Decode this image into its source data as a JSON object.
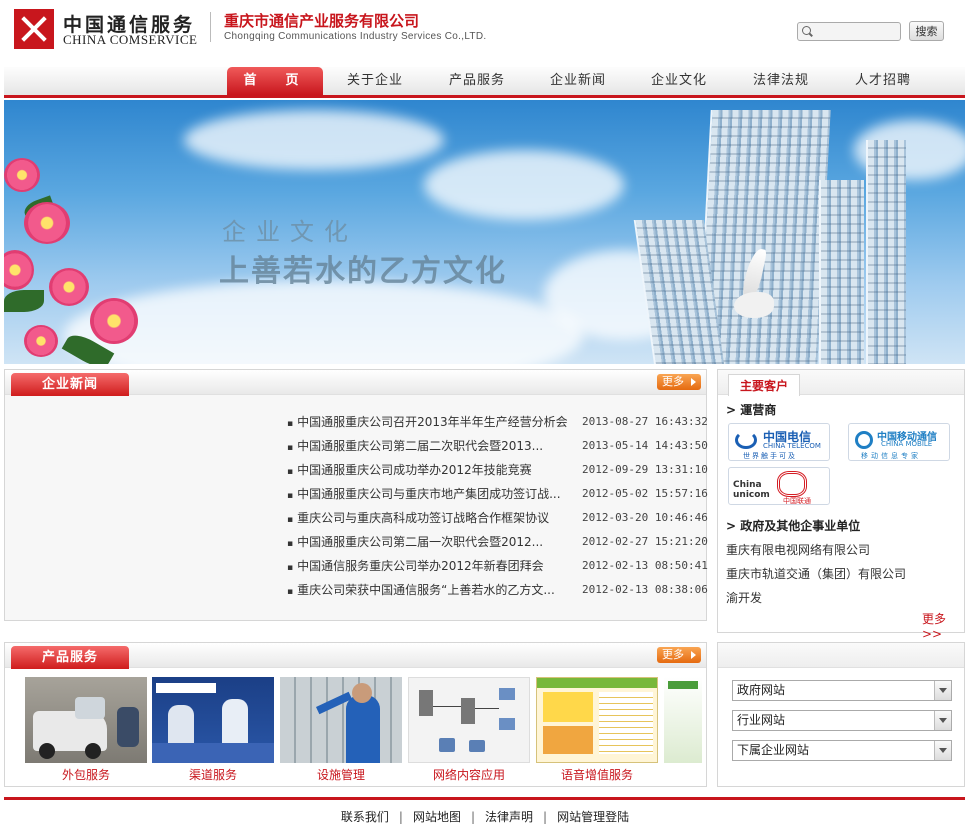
{
  "header": {
    "brand_cn": "中国通信服务",
    "brand_en": "CHINA COMSERVICE",
    "company_cn": "重庆市通信产业服务有限公司",
    "company_en": "Chongqing Communications Industry Services Co.,LTD.",
    "search_placeholder": "",
    "search_button": "搜索"
  },
  "nav": [
    "首　页",
    "关于企业",
    "产品服务",
    "企业新闻",
    "企业文化",
    "法律法规",
    "人才招聘"
  ],
  "banner": {
    "line1": "企业文化",
    "line2": "上善若水的乙方文化"
  },
  "news": {
    "title": "企业新闻",
    "more": "更多",
    "items": [
      {
        "title": "中国通服重庆公司召开2013年半年生产经营分析会",
        "date": "2013-08-27 16:43:32"
      },
      {
        "title": "中国通服重庆公司第二届二次职代会暨2013...",
        "date": "2013-05-14 14:43:50"
      },
      {
        "title": "中国通服重庆公司成功举办2012年技能竞赛",
        "date": "2012-09-29 13:31:10"
      },
      {
        "title": "中国通服重庆公司与重庆市地产集团成功签订战...",
        "date": "2012-05-02 15:57:16"
      },
      {
        "title": "重庆公司与重庆高科成功签订战略合作框架协议",
        "date": "2012-03-20 10:46:46"
      },
      {
        "title": "中国通服重庆公司第二届一次职代会暨2012...",
        "date": "2012-02-27 15:21:20"
      },
      {
        "title": "中国通信服务重庆公司举办2012年新春团拜会",
        "date": "2012-02-13 08:50:41"
      },
      {
        "title": "重庆公司荣获中国通信服务“上善若水的乙方文...",
        "date": "2012-02-13 08:38:06"
      }
    ]
  },
  "customers": {
    "title": "主要客户",
    "operators_heading": "運营商",
    "operators": [
      {
        "cn": "中国电信",
        "en": "CHINA TELECOM",
        "slogan": "世界触手可及"
      },
      {
        "cn": "中国移动通信",
        "en": "CHINA MOBILE",
        "slogan": "移动信息专家"
      },
      {
        "cn": "中国联通",
        "en": "China unicom"
      }
    ],
    "gov_heading": "政府及其他企事业单位",
    "gov": [
      "重庆有限电视网络有限公司",
      "重庆市轨道交通（集团）有限公司",
      "渝开发"
    ],
    "more": "更多>>"
  },
  "products": {
    "title": "产品服务",
    "more": "更多",
    "items": [
      "外包服务",
      "渠道服务",
      "设施管理",
      "网络内容应用",
      "语音增值服务"
    ]
  },
  "sites": {
    "selects": [
      "政府网站",
      "行业网站",
      "下属企业网站"
    ]
  },
  "footer": {
    "links": [
      "联系我们",
      "网站地图",
      "法律声明",
      "网站管理登陆"
    ]
  }
}
